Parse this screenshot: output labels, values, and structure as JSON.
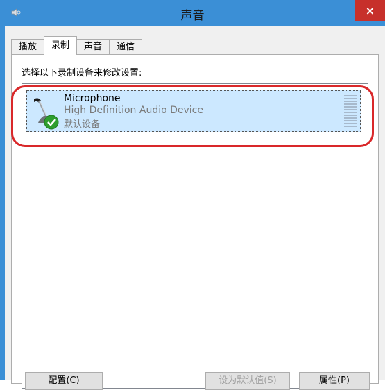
{
  "window": {
    "title": "声音"
  },
  "titlebar": {
    "close_glyph": "×"
  },
  "tabs": [
    {
      "label": "播放"
    },
    {
      "label": "录制",
      "active": true
    },
    {
      "label": "声音"
    },
    {
      "label": "通信"
    }
  ],
  "recording": {
    "instruction": "选择以下录制设备来修改设置:",
    "devices": [
      {
        "name": "Microphone",
        "description": "High Definition Audio Device",
        "status": "默认设备",
        "icon": "microphone-icon",
        "default_badge": "checkmark-icon"
      }
    ]
  },
  "buttons": {
    "configure": "配置(C)",
    "set_default": "设为默认值(S)",
    "properties": "属性(P)"
  },
  "colors": {
    "titlebar": "#3b8fd6",
    "close_button": "#c7302b",
    "selection": "#cce8ff",
    "annotation": "#d9282a"
  }
}
